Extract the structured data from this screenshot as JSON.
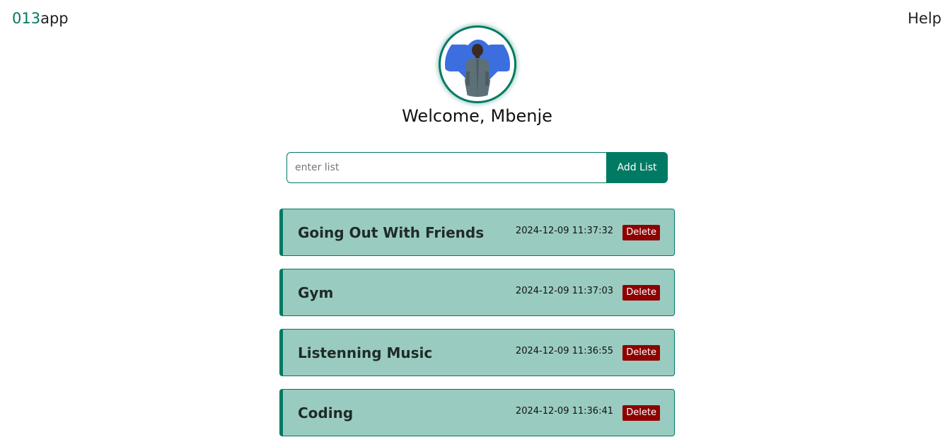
{
  "header": {
    "brand_accent": "013",
    "brand_rest": "app",
    "help_label": "Help"
  },
  "profile": {
    "welcome_prefix": "Welcome,",
    "user_name": "Mbenje",
    "avatar_icon": "user-photo"
  },
  "add_form": {
    "placeholder": "enter list",
    "value": "",
    "button_label": "Add List"
  },
  "lists": [
    {
      "title": "Going Out With Friends",
      "timestamp": "2024-12-09 11:37:32",
      "delete_label": "Delete"
    },
    {
      "title": "Gym",
      "timestamp": "2024-12-09 11:37:03",
      "delete_label": "Delete"
    },
    {
      "title": "Listenning Music",
      "timestamp": "2024-12-09 11:36:55",
      "delete_label": "Delete"
    },
    {
      "title": "Coding",
      "timestamp": "2024-12-09 11:36:41",
      "delete_label": "Delete"
    }
  ],
  "colors": {
    "accent": "#007a63",
    "card_bg": "#9acbc0",
    "delete": "#8f0000"
  }
}
